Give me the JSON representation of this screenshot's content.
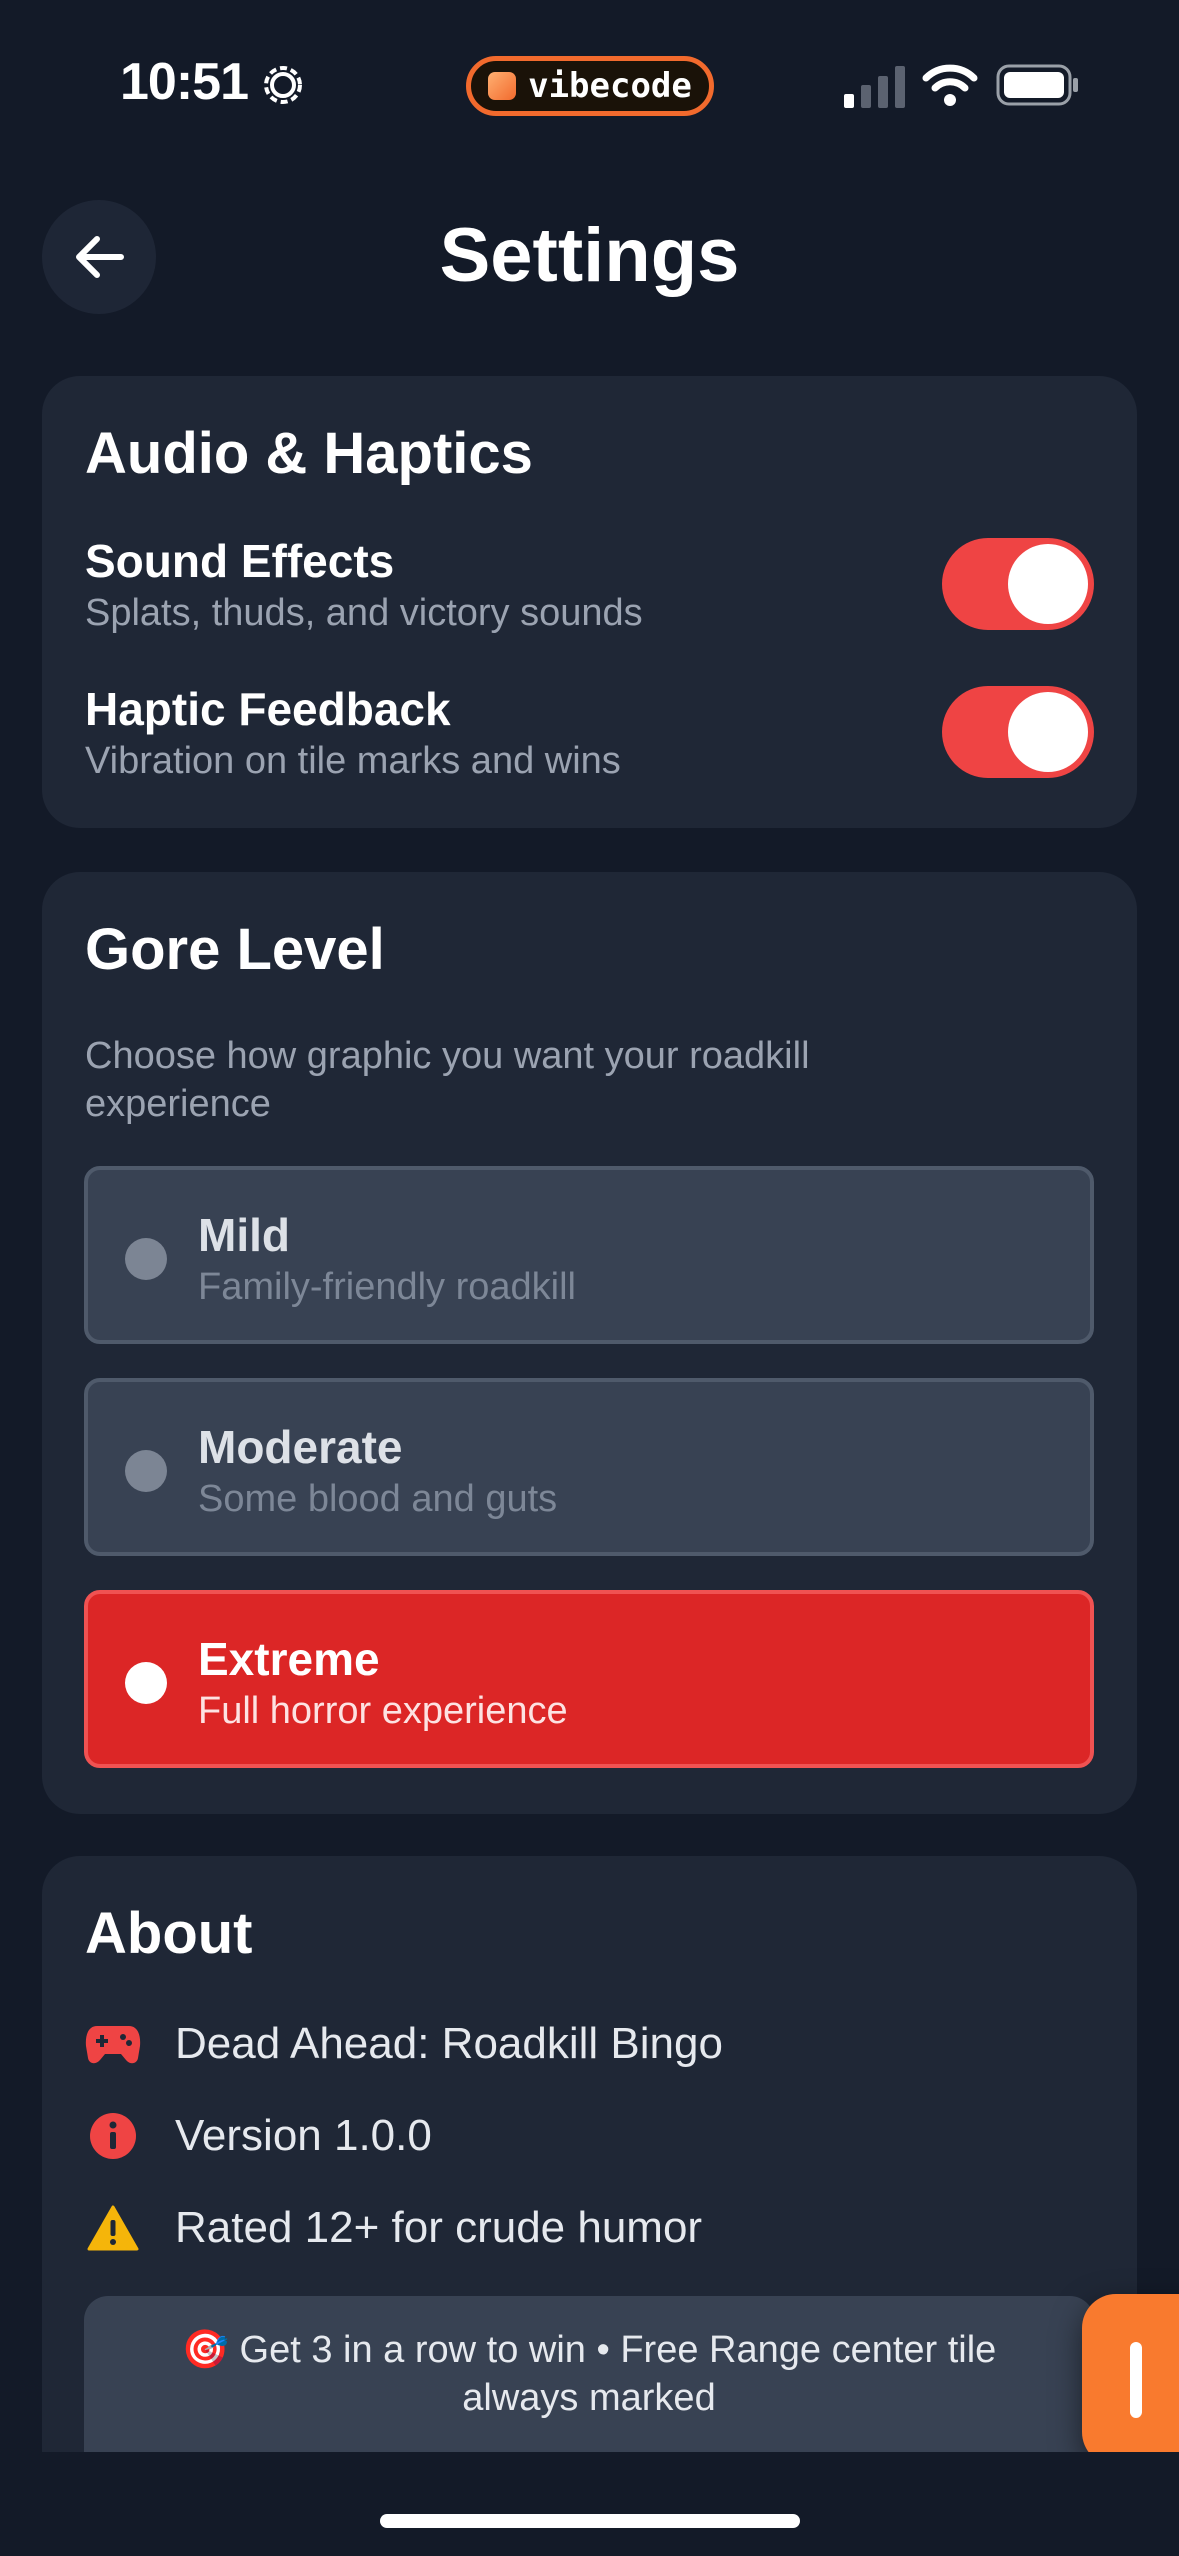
{
  "status_bar": {
    "time": "10:51",
    "pill_label": "vibecode"
  },
  "header": {
    "title": "Settings"
  },
  "audio": {
    "title": "Audio & Haptics",
    "sound": {
      "label": "Sound Effects",
      "sub": "Splats, thuds, and victory sounds",
      "enabled": true
    },
    "haptic": {
      "label": "Haptic Feedback",
      "sub": "Vibration on tile marks and wins",
      "enabled": true
    }
  },
  "gore": {
    "title": "Gore Level",
    "description": "Choose how graphic you want your roadkill experience",
    "options": [
      {
        "label": "Mild",
        "sub": "Family-friendly roadkill",
        "selected": false
      },
      {
        "label": "Moderate",
        "sub": "Some blood and guts",
        "selected": false
      },
      {
        "label": "Extreme",
        "sub": "Full horror experience",
        "selected": true
      }
    ]
  },
  "about": {
    "title": "About",
    "rows": [
      {
        "icon": "gamepad-icon",
        "text": "Dead Ahead: Roadkill Bingo"
      },
      {
        "icon": "info-icon",
        "text": "Version 1.0.0"
      },
      {
        "icon": "warning-icon",
        "text": "Rated 12+ for crude humor"
      }
    ],
    "tip": "🎯 Get 3 in a row to win • Free Range center tile always marked"
  },
  "colors": {
    "background": "#131a28",
    "card": "#1f2736",
    "accent_red": "#ef4444",
    "selected_red": "#dc2626",
    "brand_orange": "#f97a2e",
    "warning_yellow": "#f5b50a"
  }
}
